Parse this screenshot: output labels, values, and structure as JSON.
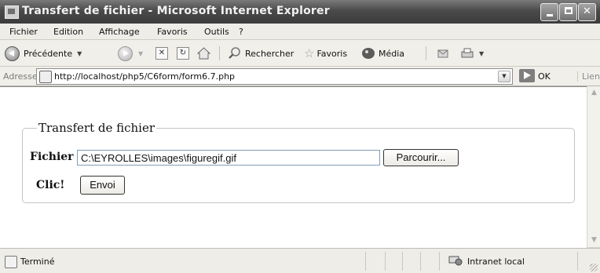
{
  "window": {
    "title": "Transfert de fichier - Microsoft Internet Explorer"
  },
  "menu": [
    "Fichier",
    "Edition",
    "Affichage",
    "Favoris",
    "Outils",
    "?"
  ],
  "toolbar": {
    "back_label": "Précédente",
    "search_label": "Rechercher",
    "favorites_label": "Favoris",
    "media_label": "Média"
  },
  "address": {
    "label": "Adresse",
    "url": "http://localhost/php5/C6form/form6.7.php",
    "go_label": "OK",
    "links_label": "Liens"
  },
  "form": {
    "legend": "Transfert de fichier",
    "file_label": "Fichier",
    "file_value": "C:\\EYROLLES\\images\\figuregif.gif",
    "browse_label": "Parcourir...",
    "click_label": "Clic!",
    "send_label": "Envoi"
  },
  "status": {
    "text": "Terminé",
    "zone": "Intranet local"
  },
  "colors": {
    "titlebar": "#4a4a4a",
    "chrome": "#efede7",
    "content_bg": "#ffffff"
  }
}
